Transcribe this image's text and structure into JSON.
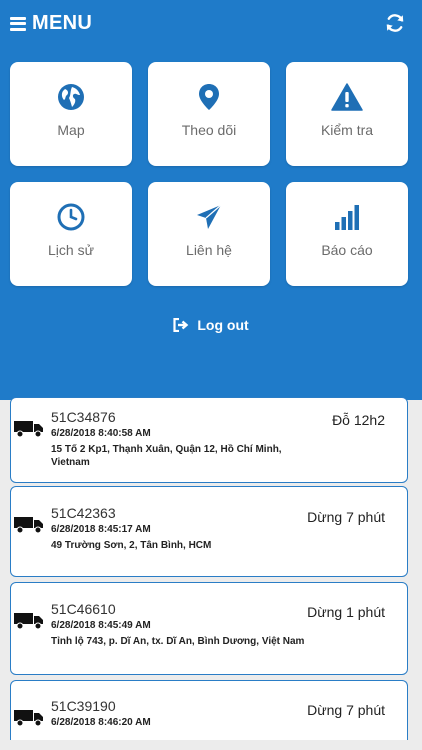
{
  "header": {
    "menu_label": "MENU"
  },
  "tiles": [
    {
      "label": "Map",
      "icon": "globe-icon"
    },
    {
      "label": "Theo dõi",
      "icon": "map-pin-icon"
    },
    {
      "label": "Kiểm tra",
      "icon": "warning-icon"
    },
    {
      "label": "Lịch sử",
      "icon": "clock-icon"
    },
    {
      "label": "Liên hệ",
      "icon": "paper-plane-icon"
    },
    {
      "label": "Báo cáo",
      "icon": "signal-bars-icon"
    }
  ],
  "logout": {
    "label": "Log out"
  },
  "vehicles": [
    {
      "plate": "51C34876",
      "status": "Đỗ 12h2",
      "time": "6/28/2018 8:40:58 AM",
      "address": "15 Tố 2 Kp1, Thạnh Xuân, Quận 12, Hồ Chí Minh, Vietnam"
    },
    {
      "plate": "51C42363",
      "status": "Dừng 7 phút",
      "time": "6/28/2018 8:45:17 AM",
      "address": "49 Trường Sơn, 2, Tân Bình, HCM"
    },
    {
      "plate": "51C46610",
      "status": "Dừng 1 phút",
      "time": "6/28/2018 8:45:49 AM",
      "address": "Tỉnh lộ 743, p. Dĩ An, tx. Dĩ An, Bình Dương, Việt Nam"
    },
    {
      "plate": "51C39190",
      "status": "Dừng 7 phút",
      "time": "6/28/2018 8:46:20 AM",
      "address": ""
    }
  ],
  "colors": {
    "primary": "#1f7bc9",
    "icon": "#1f6fb5",
    "card_border": "#2a7dc6"
  }
}
